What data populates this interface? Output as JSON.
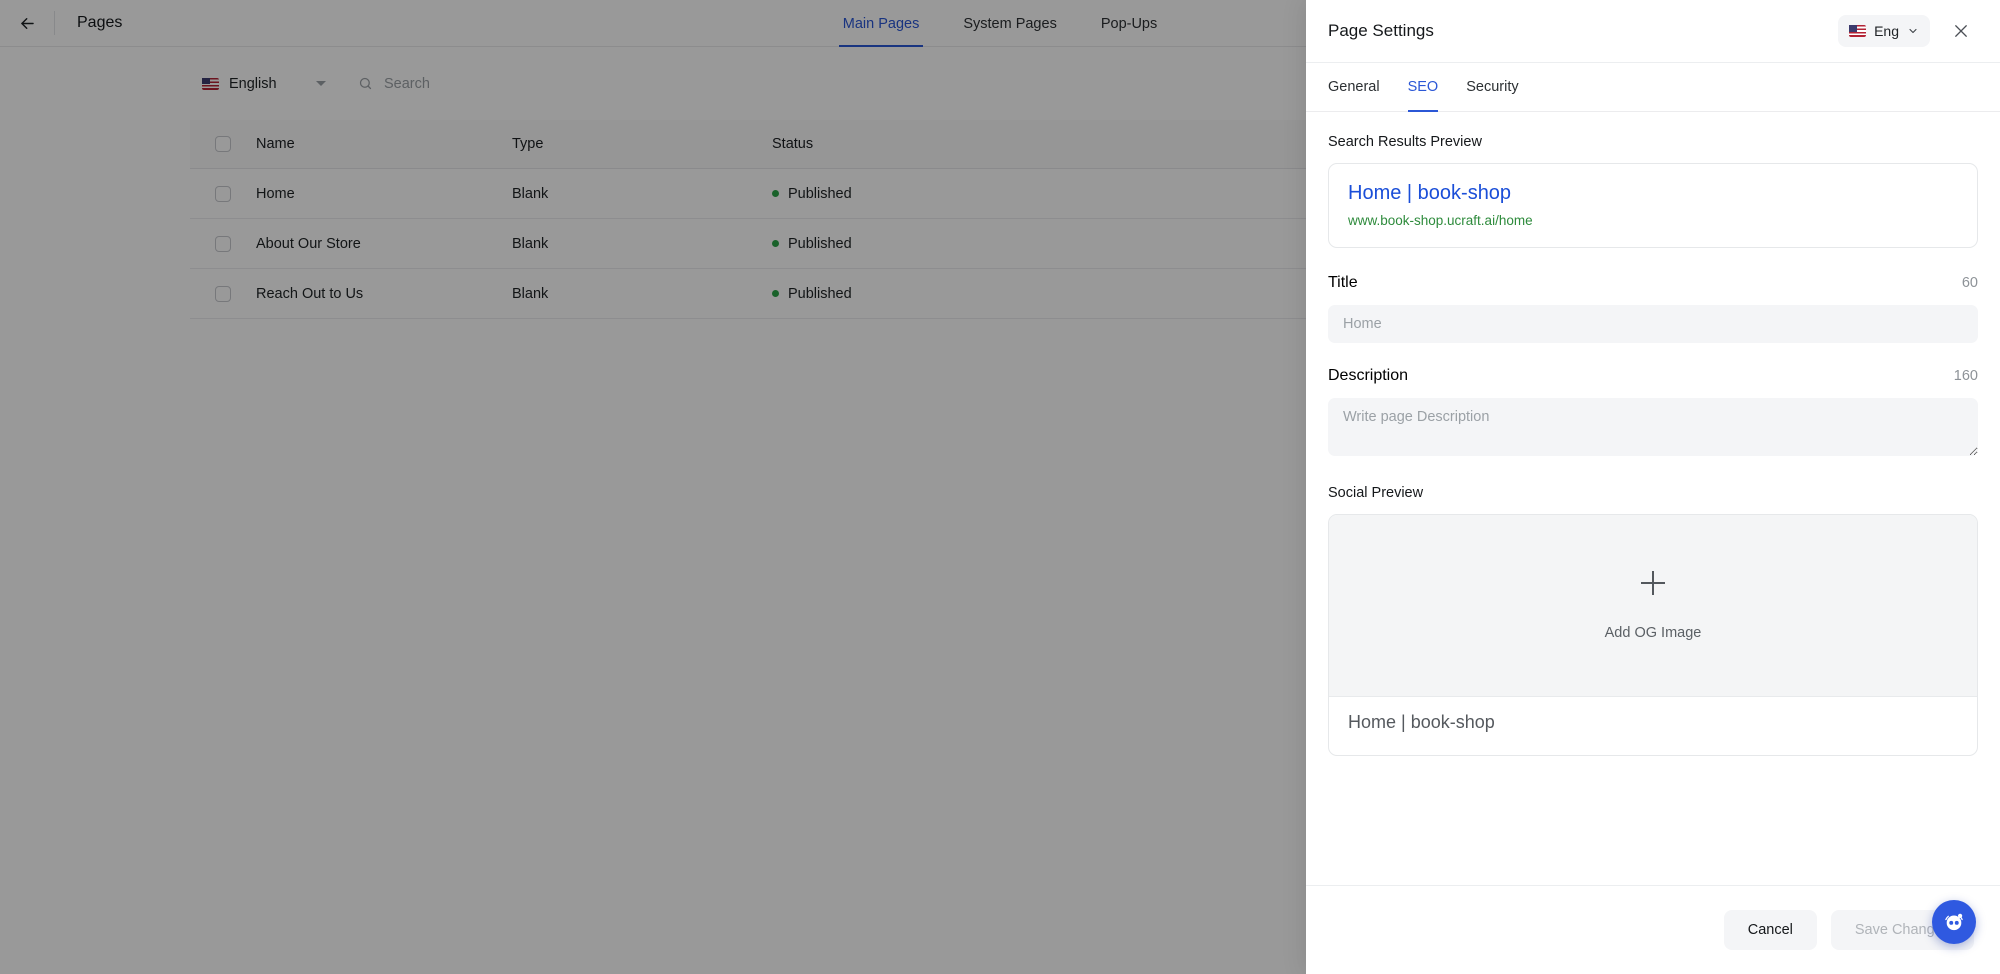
{
  "topbar": {
    "back_icon": "arrow-left-icon",
    "title": "Pages",
    "tabs": [
      {
        "label": "Main Pages",
        "active": true
      },
      {
        "label": "System Pages",
        "active": false
      },
      {
        "label": "Pop-Ups",
        "active": false
      }
    ]
  },
  "toolbar": {
    "language": "English",
    "language_flag": "us-flag-icon",
    "search_placeholder": "Search",
    "search_value": "",
    "search_icon": "search-icon",
    "chevron_icon": "chevron-down-icon"
  },
  "table": {
    "columns": [
      "Name",
      "Type",
      "Status"
    ],
    "rows": [
      {
        "name": "Home",
        "type": "Blank",
        "status": "Published",
        "status_color": "#2aa346",
        "checked": false
      },
      {
        "name": "About Our Store",
        "type": "Blank",
        "status": "Published",
        "status_color": "#2aa346",
        "checked": false
      },
      {
        "name": "Reach Out to Us",
        "type": "Blank",
        "status": "Published",
        "status_color": "#2aa346",
        "checked": false
      }
    ]
  },
  "panel": {
    "title": "Page Settings",
    "language_pill": "Eng",
    "language_pill_flag": "us-flag-icon",
    "close_icon": "close-icon",
    "tabs": [
      {
        "label": "General",
        "active": false
      },
      {
        "label": "SEO",
        "active": true
      },
      {
        "label": "Security",
        "active": false
      }
    ],
    "seo": {
      "search_preview_label": "Search Results Preview",
      "preview_title": "Home | book-shop",
      "preview_url": "www.book-shop.ucraft.ai/home",
      "title_label": "Title",
      "title_counter": "60",
      "title_value": "",
      "title_placeholder": "Home",
      "description_label": "Description",
      "description_counter": "160",
      "description_value": "",
      "description_placeholder": "Write page Description",
      "social_preview_label": "Social Preview",
      "og_add_label": "Add OG Image",
      "og_plus_icon": "plus-icon",
      "og_card_title": "Home | book-shop"
    },
    "footer": {
      "cancel_label": "Cancel",
      "save_label": "Save Changes",
      "save_disabled": true
    }
  },
  "chat_fab": {
    "icon": "chat-bot-icon",
    "color": "#2f59e0"
  },
  "colors": {
    "accent": "#2b57d6",
    "link": "#1a4ed8",
    "url_green": "#2e8b3c",
    "status_green": "#2aa346",
    "field_bg": "#f4f5f7"
  }
}
